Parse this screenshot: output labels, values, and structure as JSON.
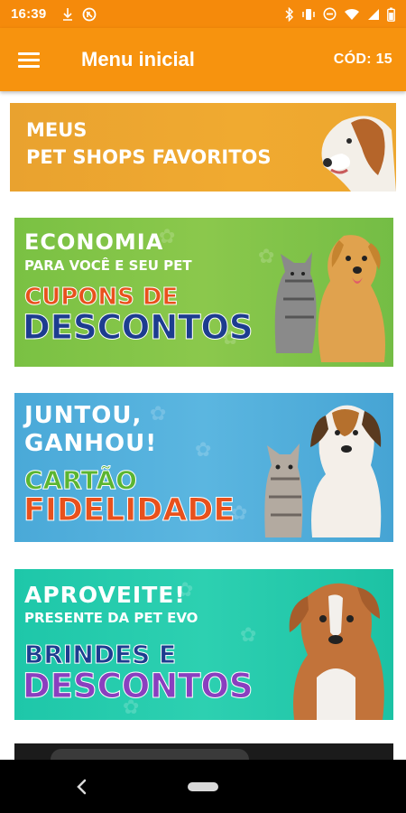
{
  "status_bar": {
    "time": "16:39",
    "icons": [
      "download-icon",
      "no-sim-icon",
      "bluetooth-icon",
      "vibrate-icon",
      "do-not-disturb-icon",
      "wifi-icon",
      "signal-icon",
      "battery-icon"
    ]
  },
  "app_bar": {
    "title": "Menu inicial",
    "code": "CÓD: 15",
    "menu_icon": "hamburger-menu-icon"
  },
  "banners": [
    {
      "lines": [
        "MEUS",
        "PET SHOPS FAVORITOS"
      ],
      "colors": {
        "bg": "#eda62e",
        "text": "#ffffff"
      }
    },
    {
      "lines": [
        "ECONOMIA",
        "PARA VOCÊ E SEU PET",
        "CUPONS DE",
        "DESCONTOS"
      ],
      "colors": {
        "bg": "#80c448",
        "accent1": "#e8511c",
        "accent2": "#1d3d8f"
      }
    },
    {
      "lines": [
        "JUNTOU,",
        "GANHOU!",
        "CARTÃO",
        "FIDELIDADE"
      ],
      "colors": {
        "bg": "#52b0dc",
        "accent1": "#5bb531",
        "accent2": "#e8511c"
      }
    },
    {
      "lines": [
        "APROVEITE!",
        "PRESENTE DA PET EVO",
        "BRINDES E",
        "DESCONTOS"
      ],
      "colors": {
        "bg": "#25cbad",
        "accent1": "#1d3d8f",
        "accent2": "#8a3fbf"
      }
    },
    {
      "lines": [],
      "colors": {
        "bg": "#1b1b1b"
      }
    }
  ],
  "nav_bar": {
    "back_icon": "back-icon",
    "home_icon": "home-pill-icon"
  }
}
